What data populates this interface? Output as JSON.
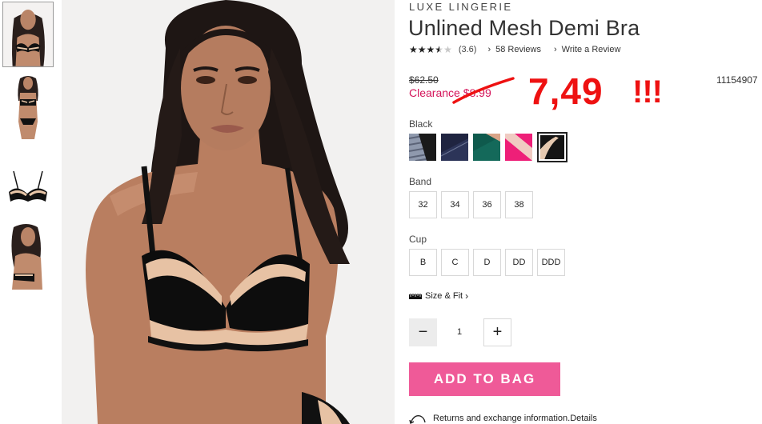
{
  "thumbnails": [
    {
      "alt": "front",
      "active": true
    },
    {
      "alt": "full-body",
      "active": false
    },
    {
      "alt": "product-flat",
      "active": false
    },
    {
      "alt": "side",
      "active": false
    }
  ],
  "product": {
    "brand": "LUXE LINGERIE",
    "title": "Unlined Mesh Demi Bra",
    "rating_value": 3.6,
    "rating_text": "(3.6)",
    "reviews_label": "58 Reviews",
    "write_review_label": "Write a Review",
    "original_price": "$62.50",
    "clearance_price": "Clearance $8.99",
    "sku": "11154907"
  },
  "annotation": {
    "price_text": "7,49",
    "exclaim_text": "!!!",
    "color": "#ee1111"
  },
  "color_option": {
    "label": "Black",
    "swatches": [
      {
        "name": "gray-stripe",
        "selected": false
      },
      {
        "name": "navy",
        "selected": false
      },
      {
        "name": "green",
        "selected": false
      },
      {
        "name": "pink",
        "selected": false
      },
      {
        "name": "black",
        "selected": true
      }
    ]
  },
  "band": {
    "label": "Band",
    "sizes": [
      "32",
      "34",
      "36",
      "38"
    ]
  },
  "cup": {
    "label": "Cup",
    "sizes": [
      "B",
      "C",
      "D",
      "DD",
      "DDD"
    ]
  },
  "size_fit_label": "Size & Fit",
  "quantity": {
    "minus": "−",
    "value": "1",
    "plus": "+"
  },
  "add_to_bag_label": "ADD TO BAG",
  "returns_text": "Returns and exchange information.",
  "details_link": "Details",
  "colors": {
    "accent_pink": "#ef5a98",
    "clearance_red": "#d4145a"
  }
}
